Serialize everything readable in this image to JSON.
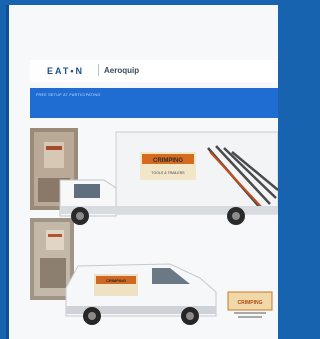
{
  "header": {
    "logo_text": "EAT•N",
    "brand_text": "Aeroquip"
  },
  "band": {
    "caption": "FREE SETUP AT PARTICIPATING"
  },
  "truck": {
    "sign_title": "CRIMPING",
    "sign_sub": "TOOLS & TRAILERS"
  },
  "van": {
    "sign_title": "CRIMPING"
  },
  "corner_badge": {
    "title": "CRIMPING"
  },
  "colors": {
    "frame_bg": "#1763b0",
    "band": "#1f6dd3",
    "logo": "#1d4f8f"
  }
}
